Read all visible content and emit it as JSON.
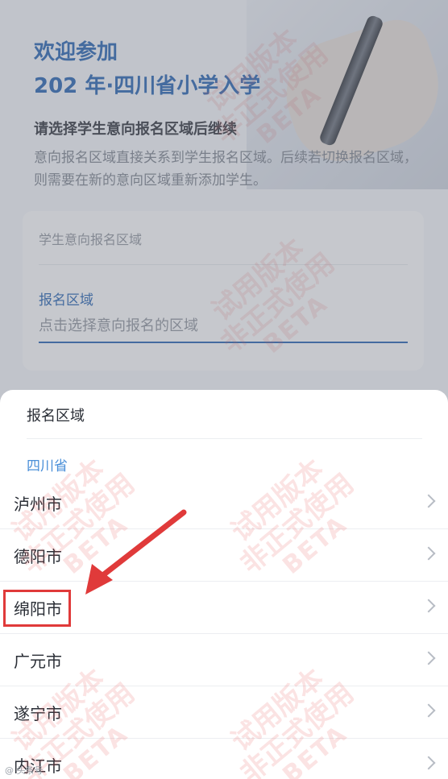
{
  "welcome": {
    "line1": "欢迎参加",
    "line2": "202  年·四川省小学入学"
  },
  "prompt": {
    "title": "请选择学生意向报名区域后继续",
    "description": "意向报名区域直接关系到学生报名区域。后续若切换报名区域，则需要在新的意向区域重新添加学生。"
  },
  "form": {
    "intent_label": "学生意向报名区域",
    "region_label": "报名区域",
    "region_placeholder": "点击选择意向报名的区域"
  },
  "watermark": {
    "line1": "试用版本",
    "line2": "非正式使用",
    "line3": "BETA"
  },
  "sheet": {
    "title": "报名区域",
    "province": "四川省",
    "cities": [
      "泸州市",
      "德阳市",
      "绵阳市",
      "广元市",
      "遂宁市",
      "内江市"
    ],
    "highlighted_city": "绵阳市"
  },
  "footer_mark": "@ 头条号",
  "colors": {
    "brand_blue": "#1f5fb0",
    "province_blue": "#4a8fd8",
    "annotation_red": "#e03a3a"
  }
}
